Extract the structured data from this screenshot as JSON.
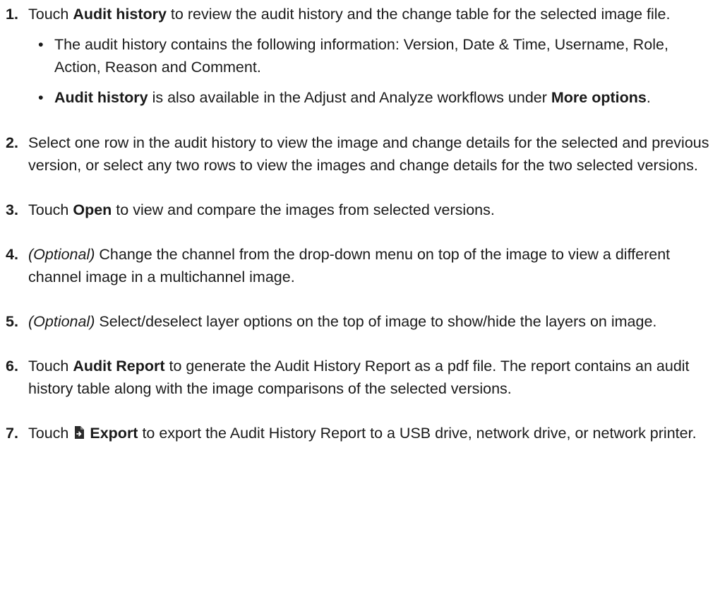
{
  "steps": [
    {
      "number": "1.",
      "t1": "Touch ",
      "b1": "Audit history",
      "t2": " to review the audit history and the change table for the selected image file.",
      "bullets": [
        {
          "text": "The audit history contains the following information: Version, Date & Time, Username, Role, Action, Reason and Comment."
        },
        {
          "b1": "Audit history",
          "t1": " is also available in the Adjust and Analyze workflows under ",
          "b2": "More options",
          "t2": "."
        }
      ]
    },
    {
      "number": "2.",
      "text": "Select one row in the audit history to view the image and change details for the selected and previous version, or select any two rows to view the images and change details for the two selected versions."
    },
    {
      "number": "3.",
      "t1": "Touch ",
      "b1": "Open",
      "t2": " to view and compare the images from selected versions."
    },
    {
      "number": "4.",
      "i1": "(Optional)",
      "t1": " Change the channel from the drop-down menu on top of the image to view a different channel image in a multichannel image."
    },
    {
      "number": "5.",
      "i1": "(Optional)",
      "t1": " Select/deselect layer options on the top of image to show/hide the layers on image."
    },
    {
      "number": "6.",
      "t1": "Touch ",
      "b1": "Audit Report",
      "t2": " to generate the Audit History Report as a pdf file. The report contains an audit history table along with the image comparisons of the selected versions."
    },
    {
      "number": "7.",
      "t1": "Touch",
      "icon": "export-icon",
      "b1": "Export",
      "t2": " to export the Audit History Report to a USB drive, network drive, or network printer."
    }
  ],
  "bullet_char": "•"
}
